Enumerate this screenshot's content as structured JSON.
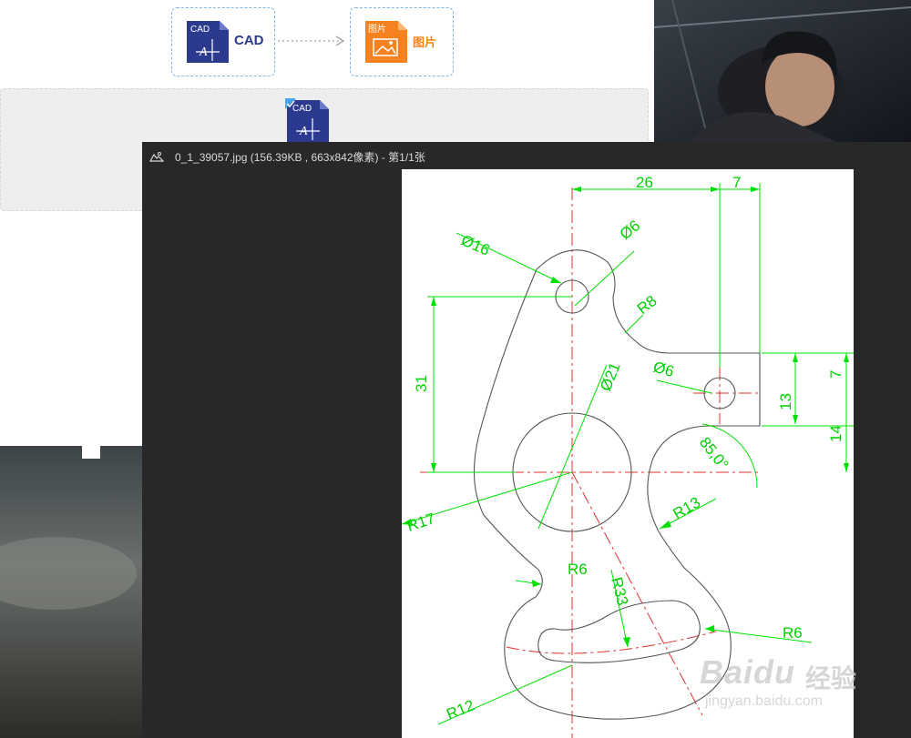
{
  "converter": {
    "source_format": {
      "badge": "CAD",
      "label": "CAD",
      "icon": "cad-file-icon",
      "color": "#2b3a8f"
    },
    "target_format": {
      "badge": "图片",
      "label": "图片",
      "icon": "image-file-icon",
      "color": "#f5821f"
    },
    "drop_file_badge": "CAD"
  },
  "viewer": {
    "title": "0_1_39057.jpg (156.39KB , 663x842像素) - 第1/1张",
    "title_icon": "image-viewer-icon"
  },
  "drawing": {
    "dimensions": {
      "top_26": "26",
      "top_7": "7",
      "dia16": "Ø16",
      "dia6_top": "Ø6",
      "r8": "R8",
      "dia21": "Ø21",
      "dia6_right": "Ø6",
      "left_31": "31",
      "right_7": "7",
      "right_13": "13",
      "right_14": "14",
      "angle": "85,0°",
      "r17": "R17",
      "r13": "R13",
      "r6_mid": "R6",
      "r33": "R33",
      "r6_right": "R6",
      "r12": "R12"
    },
    "colors": {
      "dimension": "#00e000",
      "centerline": "#e03030",
      "outline": "#555555"
    }
  },
  "watermark": {
    "brand": "Baidu",
    "cn": "经验",
    "url": "jingyan.baidu.com"
  },
  "annotation_arrow_color": "#e02020"
}
